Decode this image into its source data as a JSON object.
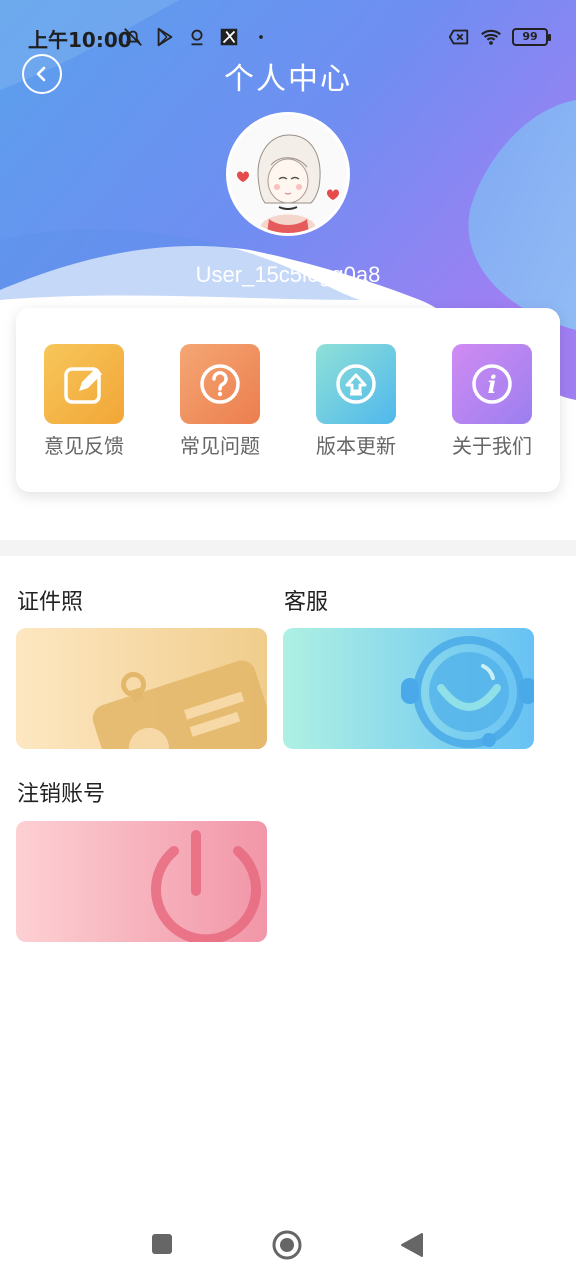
{
  "status_bar": {
    "time": "上午10:00",
    "battery": "99",
    "icons": [
      "mute-bell-icon",
      "play-store-icon",
      "location-icon",
      "app-icon",
      "dot-icon",
      "battery-x-icon",
      "wifi-icon",
      "battery-icon"
    ]
  },
  "header": {
    "title": "个人中心",
    "back_icon": "chevron-left-circle-icon"
  },
  "profile": {
    "username": "User_15c5l6gq0a8"
  },
  "menu": {
    "items": [
      {
        "label": "意见反馈",
        "icon": "edit-icon",
        "color": "#f4b23e"
      },
      {
        "label": "常见问题",
        "icon": "question-icon",
        "color": "#ee8a5c"
      },
      {
        "label": "版本更新",
        "icon": "upload-icon",
        "color": "#56c6e6"
      },
      {
        "label": "关于我们",
        "icon": "info-icon",
        "color": "#b78af0"
      }
    ]
  },
  "sections": {
    "id_photo": {
      "label": "证件照",
      "icon": "id-card-icon"
    },
    "customer_service": {
      "label": "客服",
      "icon": "headset-icon"
    },
    "cancel_account": {
      "label": "注销账号",
      "icon": "power-icon"
    }
  },
  "nav": {
    "icons": [
      "square-recents-icon",
      "circle-home-icon",
      "triangle-back-icon"
    ]
  },
  "colors": {
    "header_gradient_start": "#5b8ff0",
    "header_gradient_end": "#a37ff2"
  }
}
